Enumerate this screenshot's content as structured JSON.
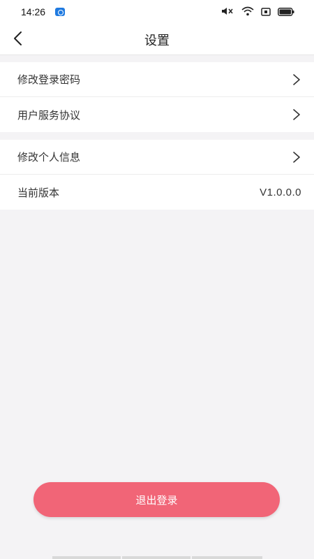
{
  "status_bar": {
    "time": "14:26"
  },
  "header": {
    "title": "设置"
  },
  "settings": {
    "group1": [
      {
        "label": "修改登录密码"
      },
      {
        "label": "用户服务协议"
      }
    ],
    "group2": {
      "profile_label": "修改个人信息",
      "version_label": "当前版本",
      "version_value": "V1.0.0.0"
    }
  },
  "logout": {
    "label": "退出登录"
  },
  "colors": {
    "accent": "#f16577",
    "background": "#f4f3f5",
    "card": "#ffffff"
  }
}
